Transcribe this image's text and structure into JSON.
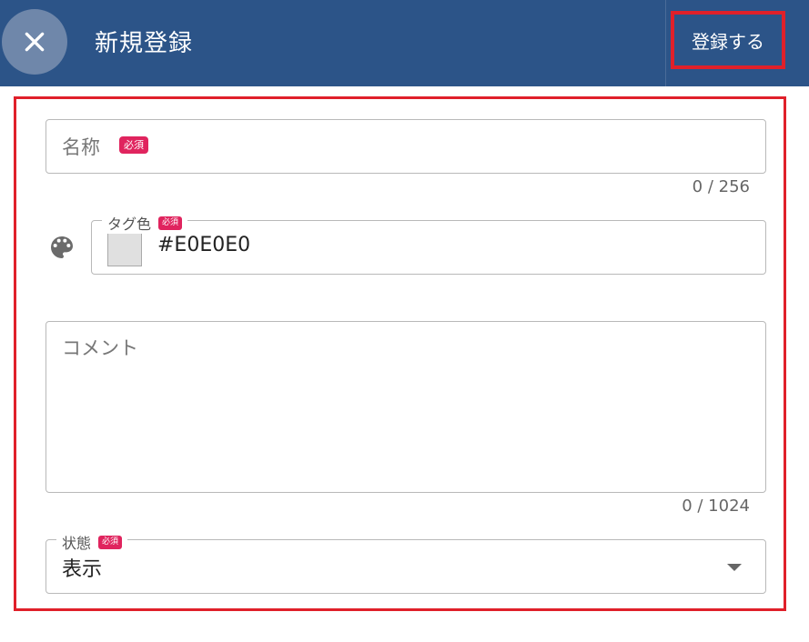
{
  "header": {
    "title": "新規登録",
    "submit_label": "登録する",
    "background_color": "#2c5488"
  },
  "form": {
    "name_field": {
      "placeholder": "名称",
      "required_badge": "必須",
      "counter": "0 / 256"
    },
    "tag_color_field": {
      "label": "タグ色",
      "required_badge": "必須",
      "value": "#E0E0E0",
      "icon": "palette-icon"
    },
    "comment_field": {
      "placeholder": "コメント",
      "counter": "0 / 1024"
    },
    "status_field": {
      "label": "状態",
      "required_badge": "必須",
      "value": "表示"
    }
  },
  "highlight_color": "#e0202a",
  "badge_color": "#e0245e"
}
